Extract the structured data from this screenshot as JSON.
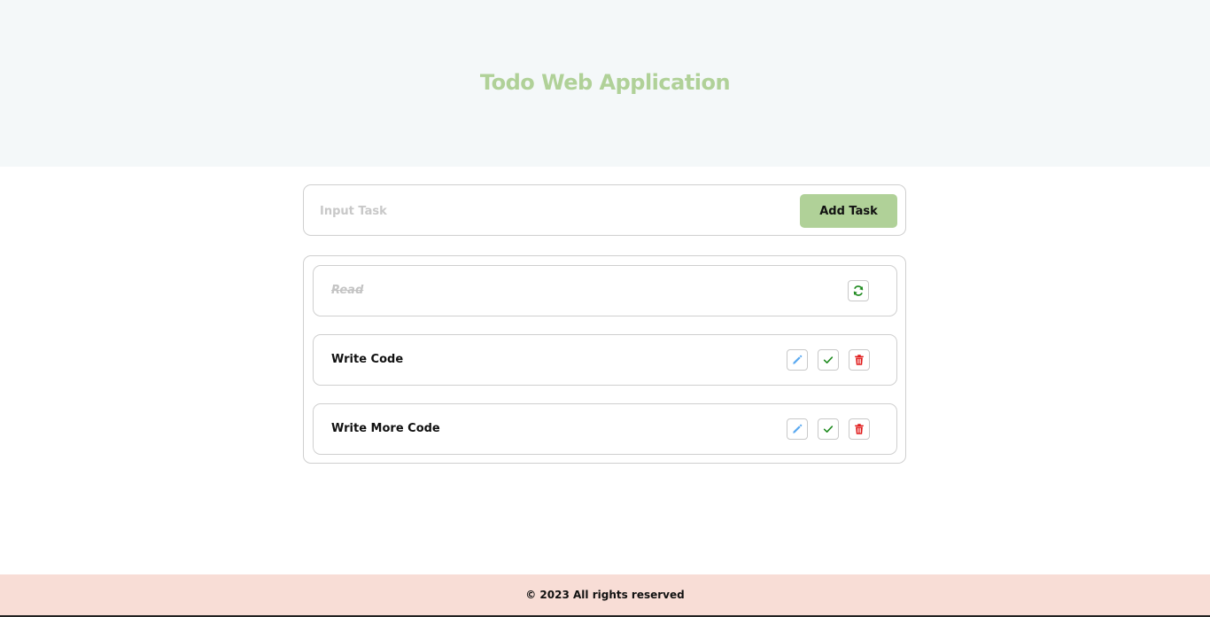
{
  "header": {
    "title": "Todo Web Application",
    "title_color": "#b0d198",
    "background": "#f4f8f9"
  },
  "task_input": {
    "placeholder": "Input Task",
    "value": ""
  },
  "add_button": {
    "label": "Add Task",
    "color": "#b0d198"
  },
  "tasks": [
    {
      "label": "Read",
      "completed": true,
      "actions": [
        "refresh-icon"
      ]
    },
    {
      "label": "Write Code",
      "completed": false,
      "actions": [
        "pencil-icon",
        "check-icon",
        "trash-icon"
      ]
    },
    {
      "label": "Write More Code",
      "completed": false,
      "actions": [
        "pencil-icon",
        "check-icon",
        "trash-icon"
      ]
    }
  ],
  "footer": {
    "text": "© 2023 All rights reserved",
    "background": "#f8ddd6"
  },
  "colors": {
    "edit": "#5aa9f0",
    "complete": "#1e8a1e",
    "delete": "#e01818",
    "restore": "#1e8a1e"
  }
}
